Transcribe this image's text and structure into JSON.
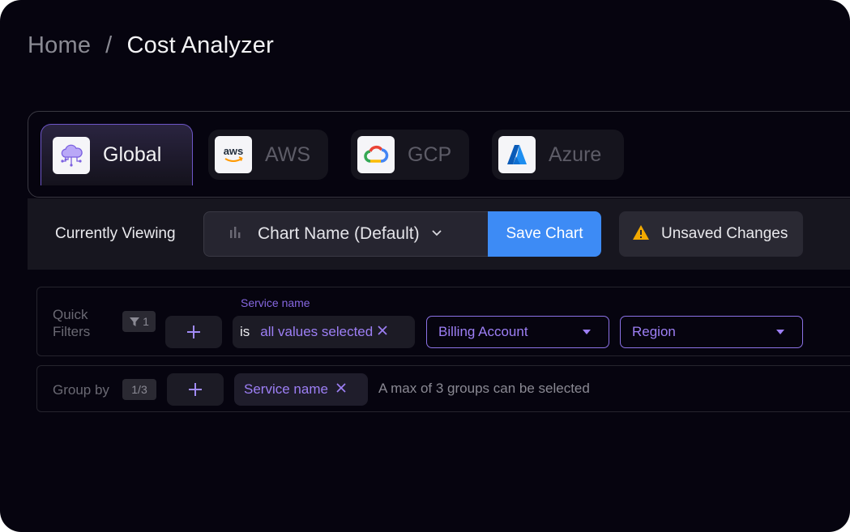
{
  "breadcrumb": {
    "home": "Home",
    "separator": "/",
    "current": "Cost Analyzer"
  },
  "providers": [
    {
      "label": "Global",
      "icon": "cloud-network-icon",
      "active": true
    },
    {
      "label": "AWS",
      "icon": "aws-logo-icon",
      "icon_text": "aws",
      "active": false
    },
    {
      "label": "GCP",
      "icon": "gcp-logo-icon",
      "active": false
    },
    {
      "label": "Azure",
      "icon": "azure-logo-icon",
      "active": false
    }
  ],
  "viewing": {
    "label": "Currently Viewing",
    "chart_name": "Chart Name (Default)",
    "save_label": "Save Chart",
    "unsaved_label": "Unsaved Changes"
  },
  "quick_filters": {
    "label_line1": "Quick",
    "label_line2": "Filters",
    "count": "1",
    "service_label": "Service name",
    "operator": "is",
    "value": "all values selected",
    "dropdowns": [
      "Billing Account",
      "Region"
    ]
  },
  "group_by": {
    "label": "Group by",
    "count": "1/3",
    "chip": "Service name",
    "note": "A max of 3 groups can be selected"
  },
  "colors": {
    "background": "#06040f",
    "accent_purple": "#9d7ff5",
    "save_blue": "#3d8bf5",
    "warning_yellow": "#f2a900"
  }
}
